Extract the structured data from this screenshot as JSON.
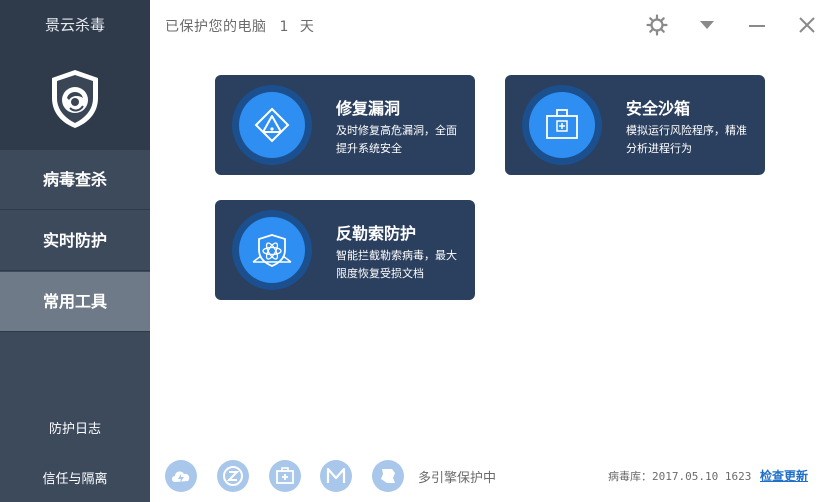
{
  "app": {
    "title": "景云杀毒"
  },
  "header": {
    "status_prefix": "已保护您的电脑",
    "days": "1",
    "unit": "天"
  },
  "sidebar": {
    "nav": [
      {
        "label": "病毒查杀",
        "active": false
      },
      {
        "label": "实时防护",
        "active": false
      },
      {
        "label": "常用工具",
        "active": true
      }
    ],
    "links": [
      {
        "label": "防护日志"
      },
      {
        "label": "信任与隔离"
      }
    ]
  },
  "tools": [
    {
      "title": "修复漏洞",
      "description": "及时修复高危漏洞，全面提升系统安全",
      "icon": "vulnerability-shield-icon"
    },
    {
      "title": "安全沙箱",
      "description": "模拟运行风险程序，精准分析进程行为",
      "icon": "sandbox-box-icon"
    },
    {
      "title": "反勒索防护",
      "description": "智能拦截勒索病毒，最大限度恢复受损文档",
      "icon": "ransomware-shield-icon"
    }
  ],
  "footer": {
    "engines": [
      "cloud-engine-icon",
      "z-engine-icon",
      "medical-kit-icon",
      "m-engine-icon",
      "network-engine-icon"
    ],
    "engine_status": "多引擎保护中",
    "db_label": "病毒库：",
    "db_version": "2017.05.10 1623",
    "check_update": "检查更新"
  },
  "colors": {
    "sidebar": "#3c4a5c",
    "sidebar_brand": "#2f3a4a",
    "nav_active": "#6f7a88",
    "card": "#2b3f5e",
    "icon_blue": "#2e8ef1",
    "link": "#1f6fcc"
  }
}
